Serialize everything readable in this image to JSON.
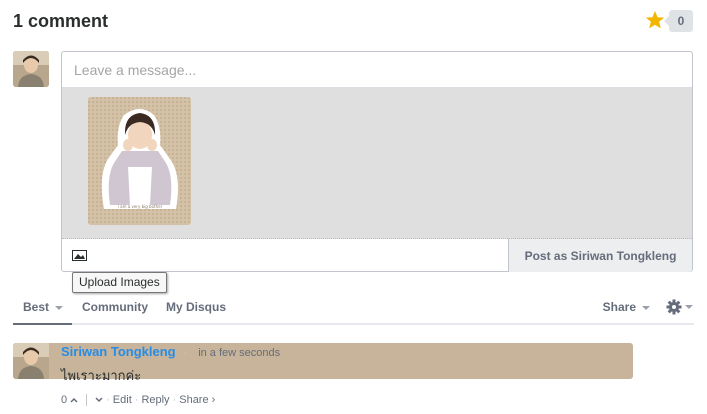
{
  "header": {
    "comment_count": "1 comment",
    "favorite_count": "0"
  },
  "composer": {
    "placeholder": "Leave a message...",
    "post_button": "Post as Siriwan Tongkleng",
    "tooltip": "Upload Images",
    "media_caption": "i am a very big bother"
  },
  "nav": {
    "tabs": [
      {
        "label": "Best"
      },
      {
        "label": "Community"
      },
      {
        "label": "My Disqus"
      }
    ],
    "share": "Share"
  },
  "post": {
    "author": "Siriwan Tongkleng",
    "separator": "·",
    "time": "in a few seconds",
    "text": "ไพเราะมากค่ะ",
    "upvotes": "0",
    "edit": "Edit",
    "reply": "Reply",
    "share": "Share ›"
  },
  "colors": {
    "accent": "#288ce4",
    "star": "#f2b600",
    "text_muted": "#656c7a"
  }
}
